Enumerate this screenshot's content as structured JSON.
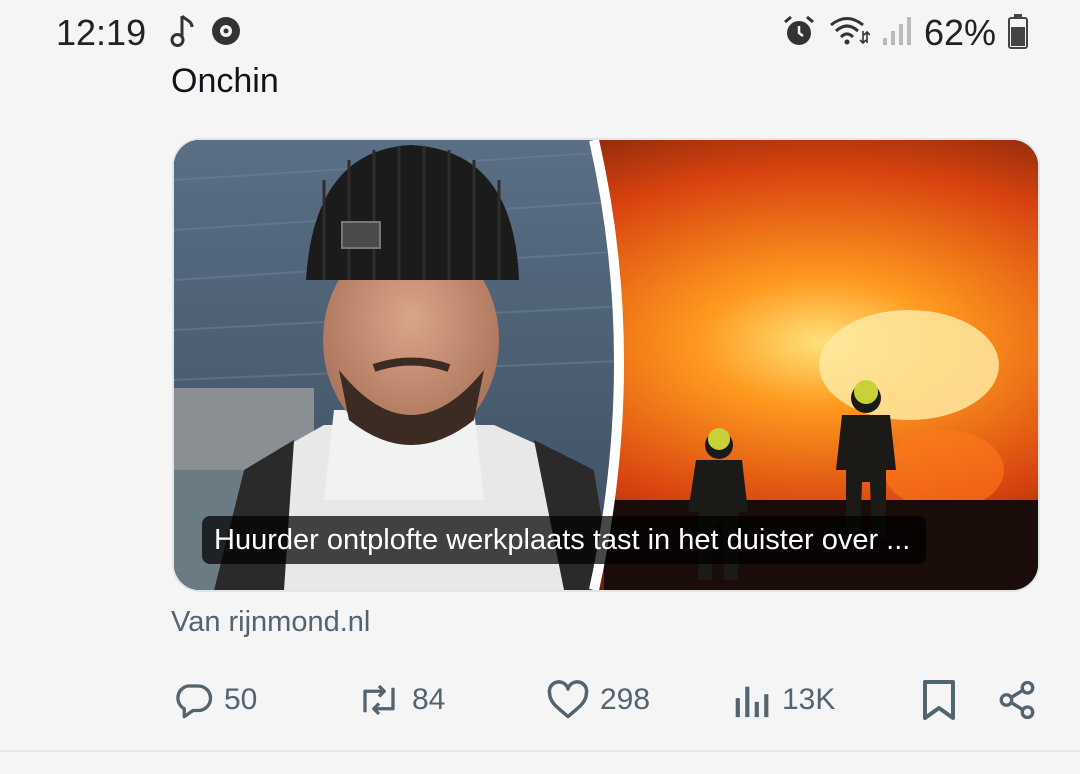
{
  "status_bar": {
    "time": "12:19",
    "battery": "62%",
    "left_icons": [
      "music-note-icon",
      "record-icon"
    ],
    "right_icons": [
      "alarm-icon",
      "wifi-icon",
      "signal-icon",
      "battery-icon"
    ]
  },
  "post": {
    "author_name": "Onchin",
    "link_card": {
      "headline": "Huurder ontplofte werkplaats tast in het duister over ...",
      "source": "Van rijnmond.nl"
    },
    "actions": {
      "replies": "50",
      "reposts": "84",
      "likes": "298",
      "views": "13K"
    }
  },
  "colors": {
    "background": "#f5f5f5",
    "text_primary": "#0f1419",
    "text_secondary": "#536471",
    "caption_bg": "#000000"
  }
}
